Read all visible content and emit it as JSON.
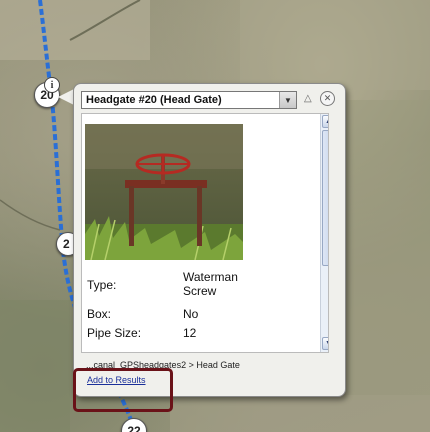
{
  "map": {
    "markers": [
      {
        "label": "20"
      },
      {
        "label": "2"
      },
      {
        "label": "22"
      }
    ],
    "info_badge": "i"
  },
  "popup": {
    "title": "Headgate #20  (Head Gate)",
    "attributes": [
      {
        "label": "Type:",
        "value": "Waterman Screw"
      },
      {
        "label": "Box:",
        "value": "No"
      },
      {
        "label": "Pipe Size:",
        "value": "12"
      }
    ],
    "path_text": "...canal_GPSheadgates2 > Head Gate",
    "add_to_results": "Add to Results"
  },
  "colors": {
    "canal": "#2a6fd6",
    "highlight": "#6a1218",
    "link": "#1a2f9a"
  }
}
